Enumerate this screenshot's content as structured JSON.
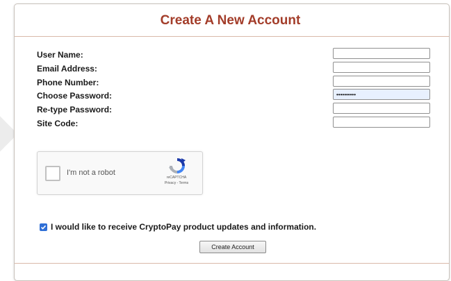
{
  "form": {
    "title": "Create A New Account",
    "fields": [
      {
        "label": "User Name:",
        "value": ""
      },
      {
        "label": "Email Address:",
        "value": ""
      },
      {
        "label": "Phone Number:",
        "value": ""
      },
      {
        "label": "Choose Password:",
        "value": "••••••••••"
      },
      {
        "label": "Re-type Password:",
        "value": ""
      },
      {
        "label": "Site Code:",
        "value": ""
      }
    ]
  },
  "captcha": {
    "label": "I'm not a robot",
    "brand": "reCAPTCHA",
    "links": "Privacy - Terms",
    "checked": false
  },
  "consent": {
    "text": "I would like to receive CryptoPay product updates and information.",
    "checked": true
  },
  "submit": {
    "label": "Create Account"
  },
  "colors": {
    "title": "#a33d2a",
    "checkbox_accent": "#2f6fd6",
    "active_field_bg": "#e8f0fe"
  }
}
